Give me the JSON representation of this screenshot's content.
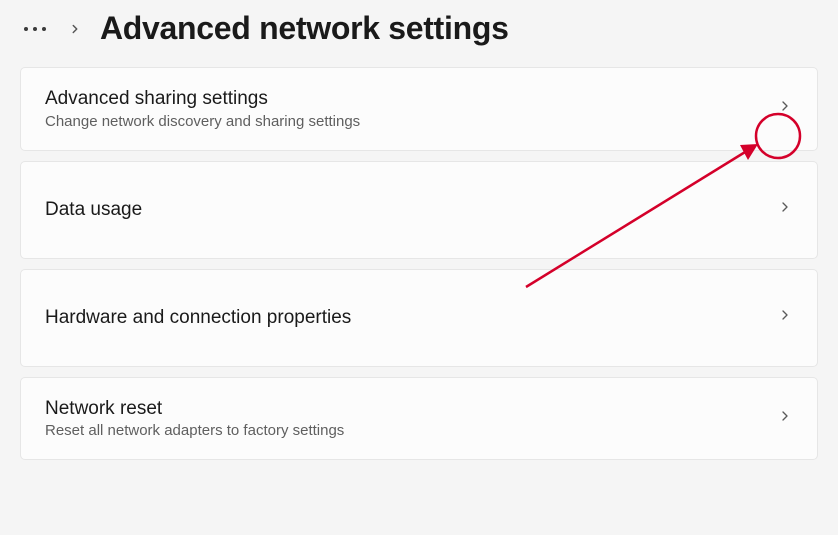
{
  "header": {
    "title": "Advanced network settings"
  },
  "cards": [
    {
      "id": "advanced-sharing",
      "title": "Advanced sharing settings",
      "desc": "Change network discovery and sharing settings"
    },
    {
      "id": "data-usage",
      "title": "Data usage",
      "desc": ""
    },
    {
      "id": "hardware-props",
      "title": "Hardware and connection properties",
      "desc": ""
    },
    {
      "id": "network-reset",
      "title": "Network reset",
      "desc": "Reset all network adapters to factory settings"
    }
  ]
}
